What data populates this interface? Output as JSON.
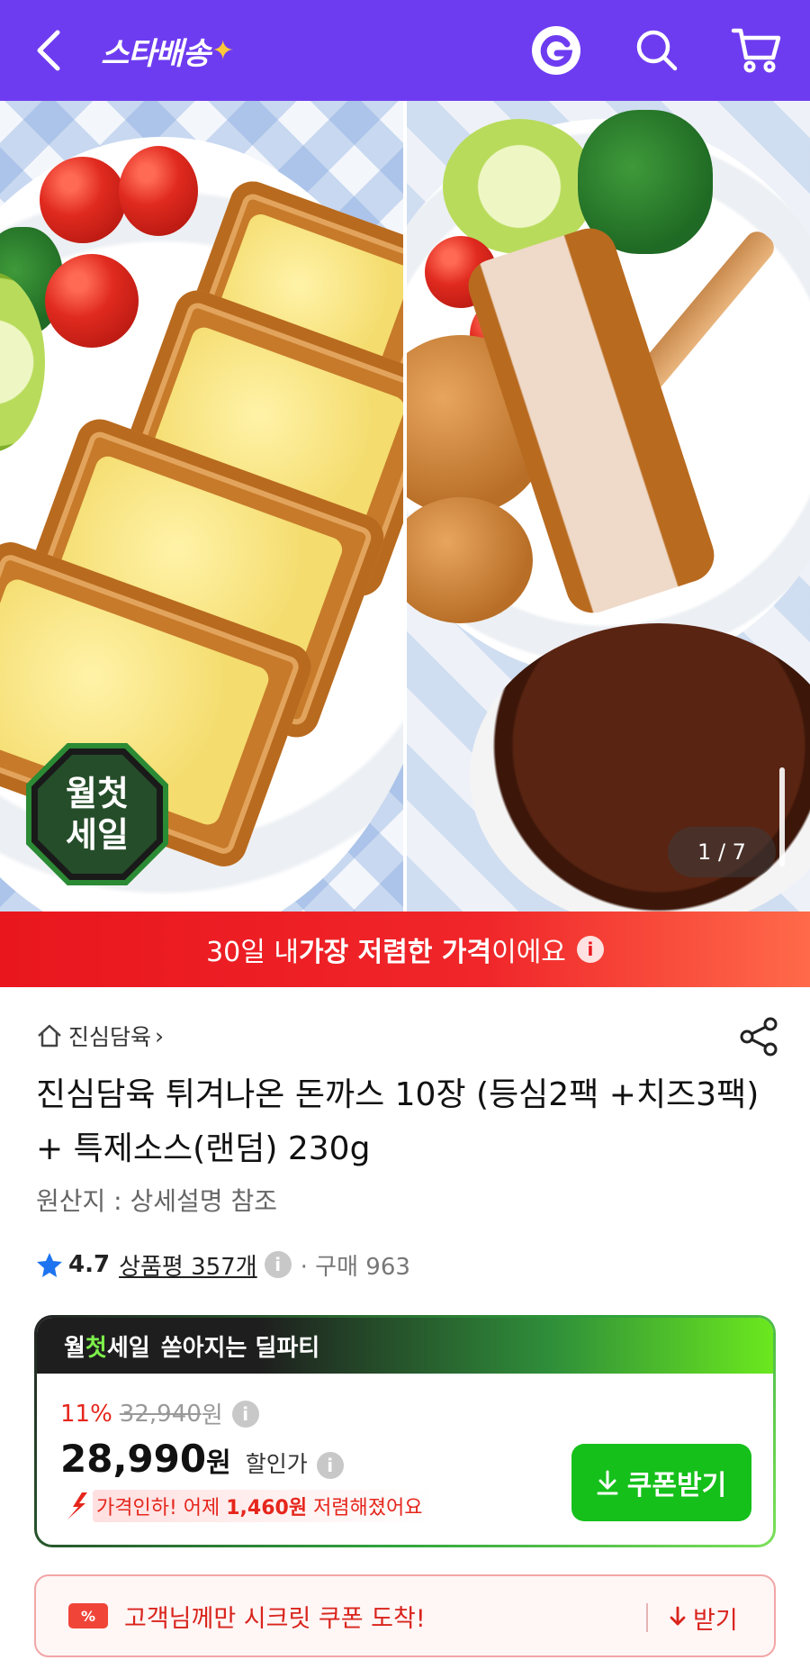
{
  "header": {
    "brand_name": "스타배송",
    "brand_sparkle": "✦",
    "icons": [
      "back-icon",
      "g-icon",
      "search-icon",
      "cart-icon"
    ],
    "accent_color": "#6e3cf0"
  },
  "gallery": {
    "page_indicator": "1 / 7",
    "badge_line1": "월첫",
    "badge_line2": "세일"
  },
  "banner": {
    "prefix": "30일 내 ",
    "bold": "가장 저렴한 가격",
    "suffix": "이에요",
    "info": "i",
    "color": "#e9161e"
  },
  "product": {
    "store": "진심담육",
    "store_chevron": "›",
    "title": "진심담육 튀겨나온 돈까스 10장 (등심2팩 +치즈3팩) + 특제소스(랜덤) 230g",
    "origin": "원산지 : 상세설명 참조",
    "rating": "4.7",
    "reviews": "상품평 357개",
    "info": "i",
    "purchase": "· 구매 963"
  },
  "deal": {
    "head_a": "월",
    "head_b": "첫",
    "head_c": "세일",
    "head_tag": "쏟아지는 딜파티",
    "discount": "11%",
    "original_price": "32,940",
    "original_unit": "원",
    "price": "28,990",
    "price_unit": "원",
    "price_label": "할인가",
    "info": "i",
    "drop_prefix": "가격인하! 어제 ",
    "drop_amount": "1,460원",
    "drop_suffix": " 저렴해졌어요",
    "coupon_button": "쿠폰받기"
  },
  "secret_coupon": {
    "tag": "%",
    "text": "고객님께만 시크릿 쿠폰 도착!",
    "action": "받기"
  }
}
